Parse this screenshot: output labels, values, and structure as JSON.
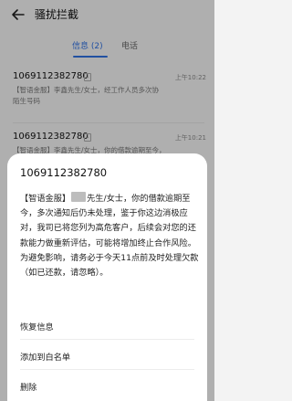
{
  "header": {
    "title": "骚扰拦截"
  },
  "tabs": [
    {
      "label": "信息 (2)",
      "active": true
    },
    {
      "label": "电话",
      "active": false
    }
  ],
  "messages": [
    {
      "sender": "1069112382780",
      "time": "上午10:22",
      "sim": "1",
      "preview_line1": "【智语金服】李鑫先生/女士，经工作人员多次协",
      "preview_line2": "陌生号码"
    },
    {
      "sender": "1069112382780",
      "time": "上午10:21",
      "sim": "1",
      "preview_line1": "【智语金服】李鑫先生/女士，你的借款逾期至今，"
    }
  ],
  "sheet": {
    "sender": "1069112382780",
    "body_prefix": "【智语金服】",
    "body_rest": "先生/女士，你的借款逾期至今，多次通知后仍未处理，鉴于你这边消极应对，我司已将您列为高危客户，后续会对您的还款能力做重新评估，可能将增加终止合作风险。为避免影响，请务必于今天11点前及时处理欠款（如已还款，请忽略）。",
    "actions": [
      "恢复信息",
      "添加到白名单",
      "删除"
    ]
  },
  "colors": {
    "accent": "#2f6fe0",
    "background": "#f3f3f3",
    "sheet": "#ffffff"
  }
}
